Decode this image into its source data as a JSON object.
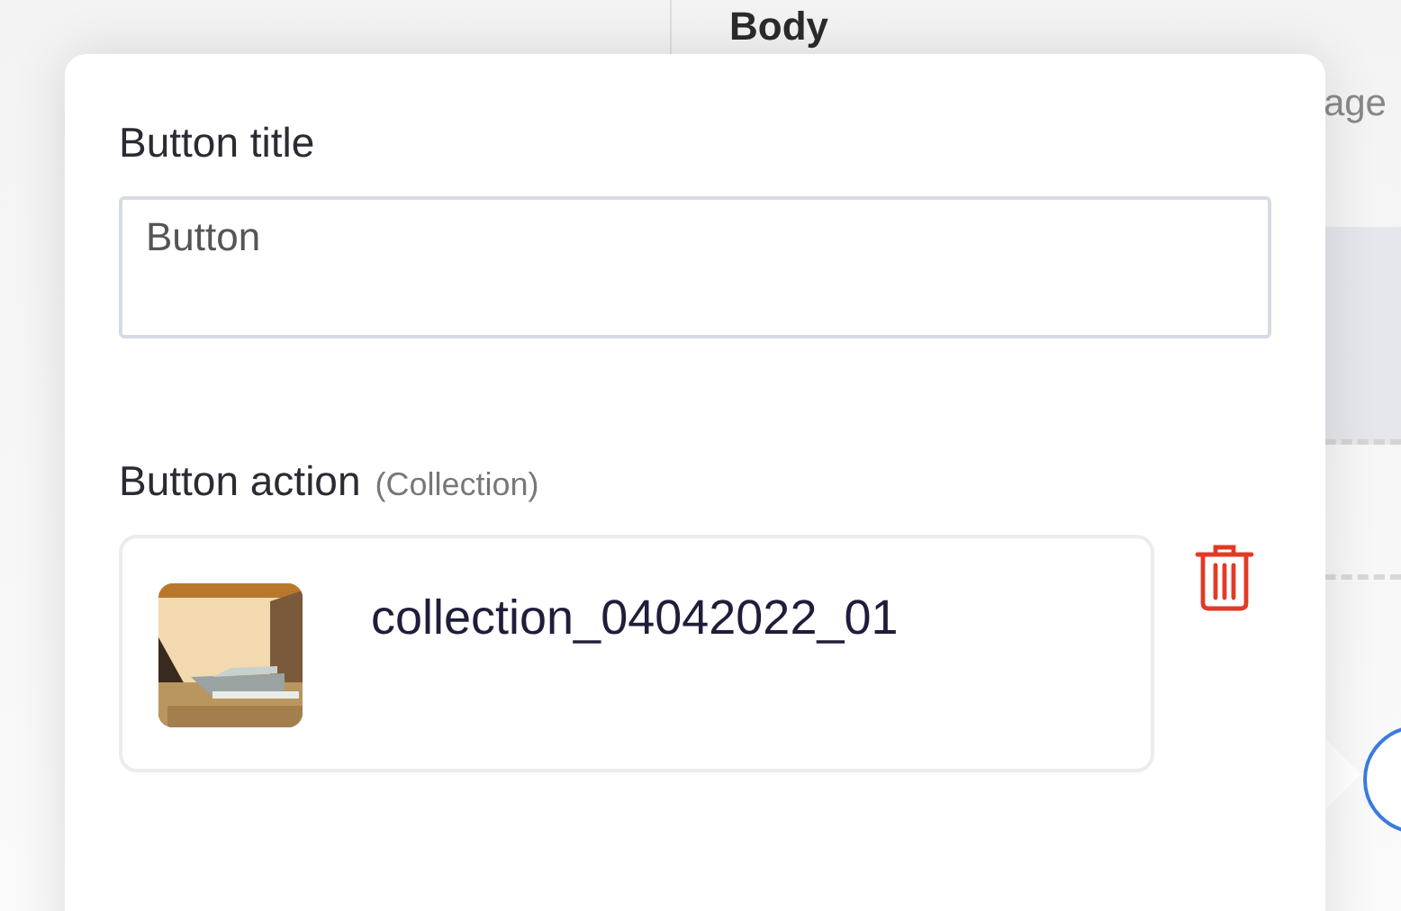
{
  "background": {
    "heading": "Body",
    "text_fragment": "age"
  },
  "popup": {
    "title_field": {
      "label": "Button title",
      "value": "Button"
    },
    "action": {
      "label": "Button action",
      "type_note": "(Collection)",
      "item": {
        "name": "collection_04042022_01"
      }
    }
  }
}
